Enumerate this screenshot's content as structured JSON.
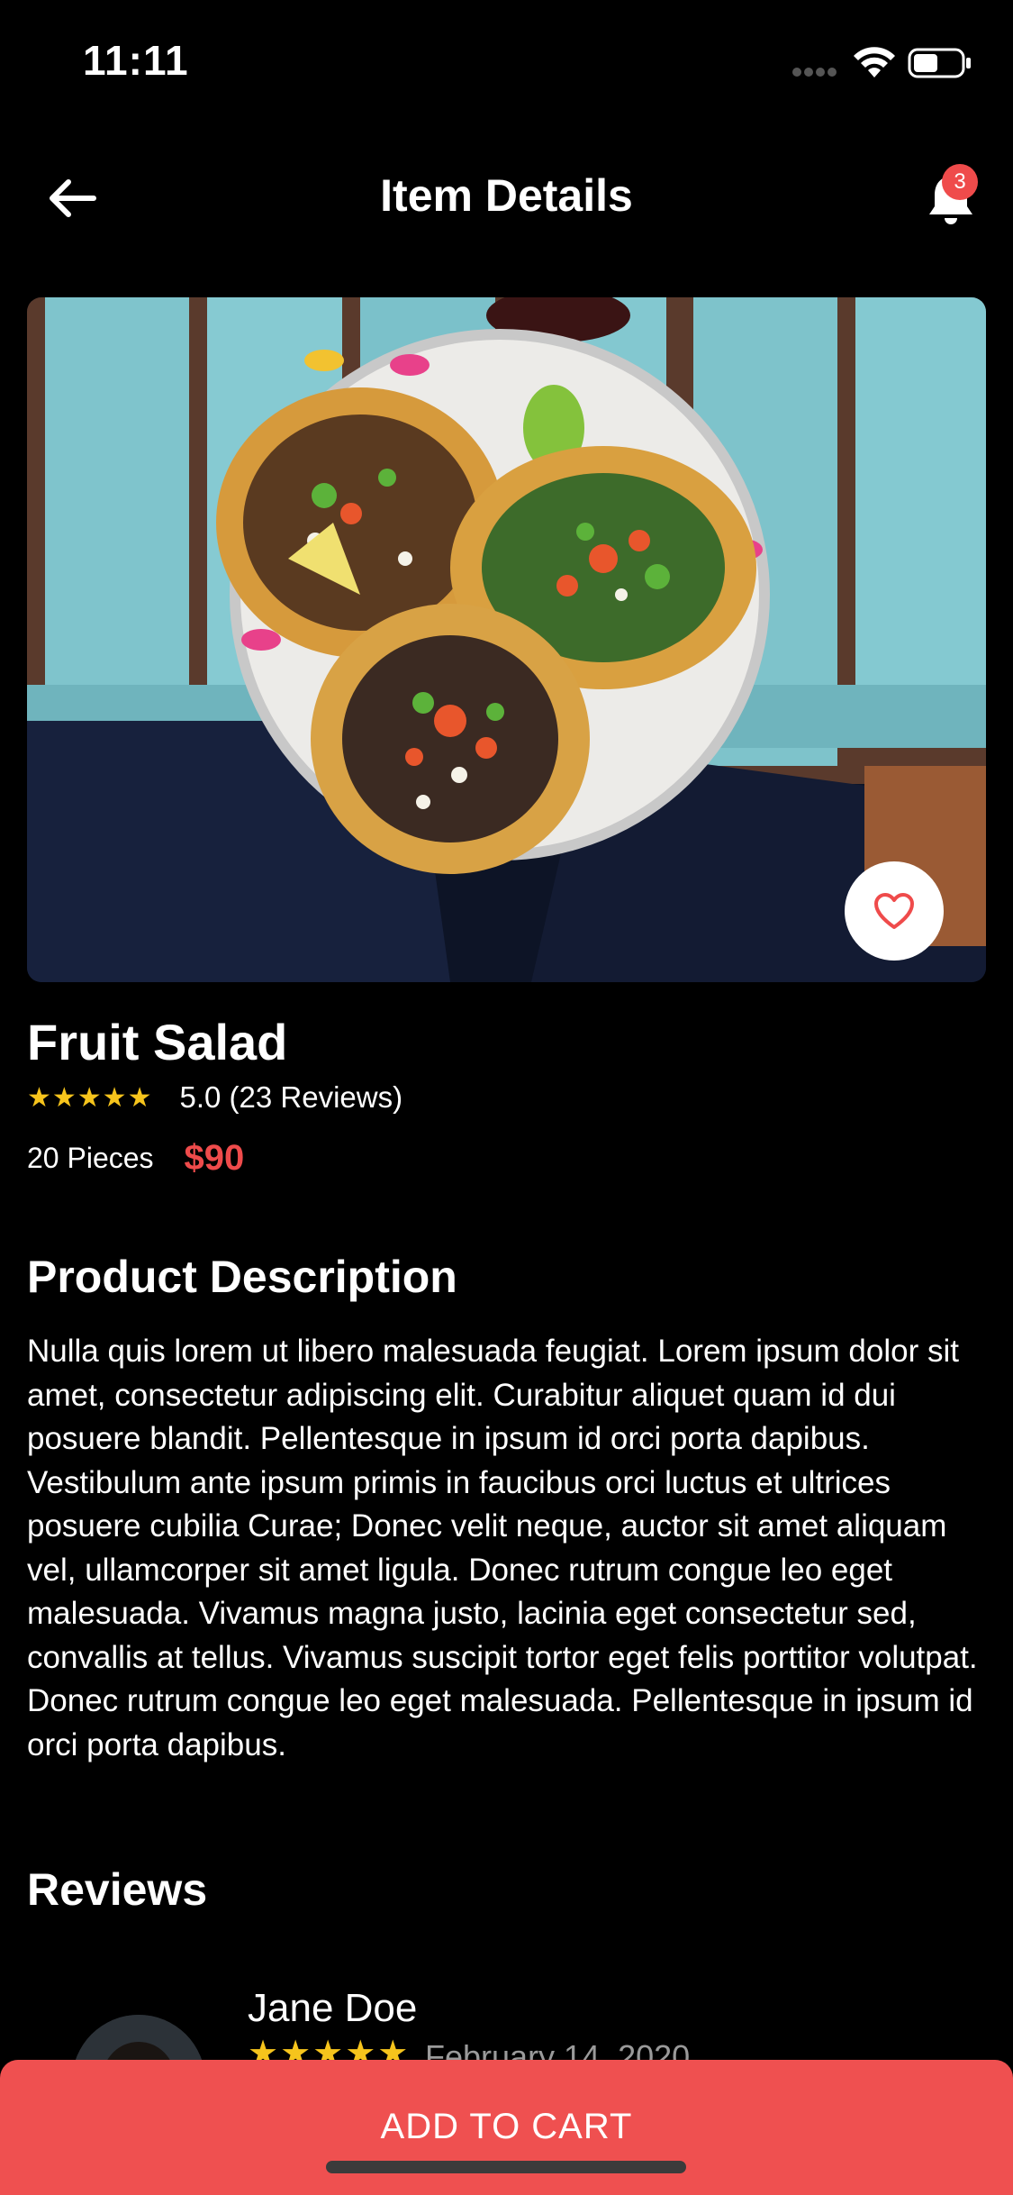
{
  "status_bar": {
    "time": "11:11"
  },
  "header": {
    "title": "Item Details",
    "notification_count": "3"
  },
  "product": {
    "name": "Fruit Salad",
    "stars": "★★★★★",
    "rating_text": "5.0 (23 Reviews)",
    "pieces": "20 Pieces",
    "price": "$90"
  },
  "description": {
    "title": "Product Description",
    "body": "Nulla quis lorem ut libero malesuada feugiat. Lorem ipsum dolor sit amet, consectetur adipiscing elit. Curabitur aliquet quam id dui posuere blandit. Pellentesque in ipsum id orci porta dapibus. Vestibulum ante ipsum primis in faucibus orci luctus et ultrices posuere cubilia Curae; Donec velit neque, auctor sit amet aliquam vel, ullamcorper sit amet ligula. Donec rutrum congue leo eget malesuada. Vivamus magna justo, lacinia eget consectetur sed, convallis at tellus. Vivamus suscipit tortor eget felis porttitor volutpat. Donec rutrum congue leo eget malesuada. Pellentesque in ipsum id orci porta dapibus."
  },
  "reviews": {
    "title": "Reviews",
    "items": [
      {
        "name": "Jane Doe",
        "stars": "★★★★★",
        "date": "February 14, 2020"
      }
    ]
  },
  "cta": {
    "label": "ADD TO CART"
  },
  "colors": {
    "accent": "#ef5050",
    "price": "#ef4b4b",
    "star": "#f6c41c",
    "background": "#000000"
  }
}
